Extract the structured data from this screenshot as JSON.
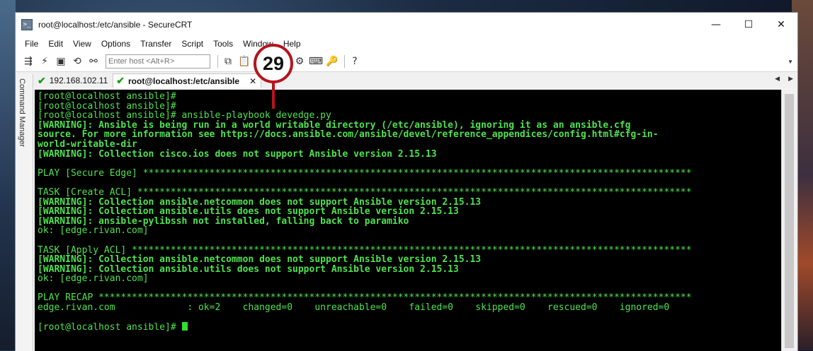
{
  "window": {
    "title": "root@localhost:/etc/ansible - SecureCRT",
    "controls": {
      "minimize": "—",
      "maximize": "☐",
      "close": "✕"
    }
  },
  "menu": [
    "File",
    "Edit",
    "View",
    "Options",
    "Transfer",
    "Script",
    "Tools",
    "Window",
    "Help"
  ],
  "toolbar": {
    "host_placeholder": "Enter host <Alt+R>"
  },
  "tabs": [
    {
      "label": "192.168.102.11",
      "status": "connected",
      "active": false
    },
    {
      "label": "root@localhost:/etc/ansible",
      "status": "connected",
      "active": true,
      "close": "✕"
    }
  ],
  "side_panel": {
    "label": "Command Manager"
  },
  "badge": {
    "number": "29"
  },
  "terminal": {
    "lines": [
      {
        "text": "[root@localhost ansible]#",
        "bold": false
      },
      {
        "text": "[root@localhost ansible]#",
        "bold": false
      },
      {
        "text": "[root@localhost ansible]# ansible-playbook devedge.py",
        "bold": false
      },
      {
        "text": "[WARNING]: Ansible is being run in a world writable directory (/etc/ansible), ignoring it as an ansible.cfg",
        "bold": true
      },
      {
        "text": "source. For more information see https://docs.ansible.com/ansible/devel/reference_appendices/config.html#cfg-in-",
        "bold": true
      },
      {
        "text": "world-writable-dir",
        "bold": true
      },
      {
        "text": "[WARNING]: Collection cisco.ios does not support Ansible version 2.15.13",
        "bold": true
      },
      {
        "text": "",
        "bold": false
      },
      {
        "text": "PLAY [Secure Edge] ***************************************************************************************************",
        "bold": false
      },
      {
        "text": "",
        "bold": false
      },
      {
        "text": "TASK [Create ACL] ****************************************************************************************************",
        "bold": false
      },
      {
        "text": "[WARNING]: Collection ansible.netcommon does not support Ansible version 2.15.13",
        "bold": true
      },
      {
        "text": "[WARNING]: Collection ansible.utils does not support Ansible version 2.15.13",
        "bold": true
      },
      {
        "text": "[WARNING]: ansible-pylibssh not installed, falling back to paramiko",
        "bold": true
      },
      {
        "text": "ok: [edge.rivan.com]",
        "bold": false
      },
      {
        "text": "",
        "bold": false
      },
      {
        "text": "TASK [Apply ACL] *****************************************************************************************************",
        "bold": false
      },
      {
        "text": "[WARNING]: Collection ansible.netcommon does not support Ansible version 2.15.13",
        "bold": true
      },
      {
        "text": "[WARNING]: Collection ansible.utils does not support Ansible version 2.15.13",
        "bold": true
      },
      {
        "text": "ok: [edge.rivan.com]",
        "bold": false
      },
      {
        "text": "",
        "bold": false
      },
      {
        "text": "PLAY RECAP ***********************************************************************************************************",
        "bold": false
      },
      {
        "text": "edge.rivan.com             : ok=2    changed=0    unreachable=0    failed=0    skipped=0    rescued=0    ignored=0",
        "bold": false
      },
      {
        "text": "",
        "bold": false
      }
    ],
    "prompt": "[root@localhost ansible]# "
  },
  "colors": {
    "terminal_bg": "#000000",
    "terminal_fg": "#4fe24f",
    "badge_ring": "#b5141c",
    "tab_check": "#1a9c1a"
  }
}
